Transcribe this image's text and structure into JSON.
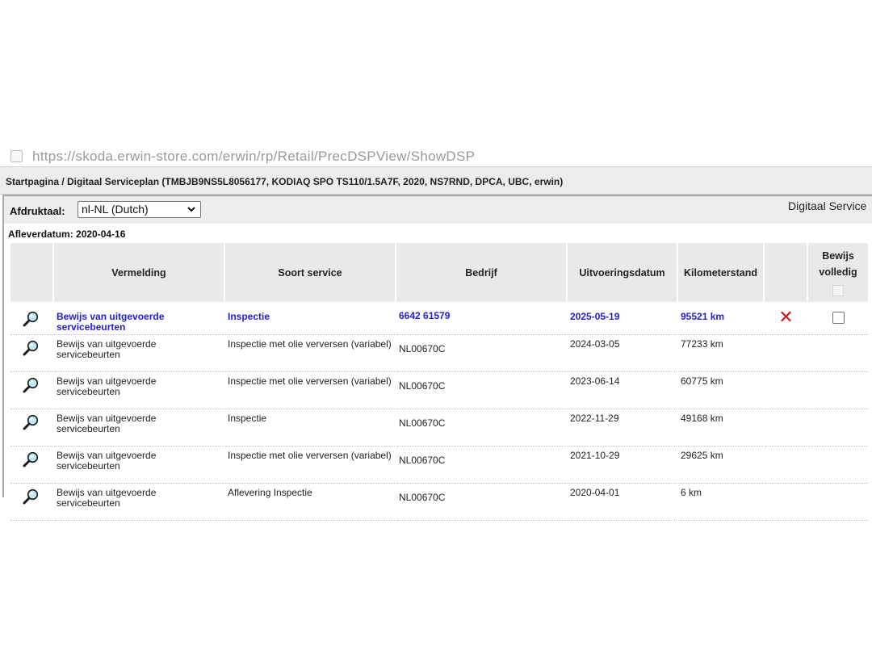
{
  "browser": {
    "url_fragment": "https://skoda.erwin-store.com/erwin/rp/Retail/PrecDSPView/ShowDSP"
  },
  "breadcrumb": "Startpagina / Digitaal Serviceplan (TMBJB9NS5L8056177, KODIAQ SPO TS110/1.5A7F, 2020, NS7RND, DPCA, UBC, erwin)",
  "toolbar": {
    "print_language_label": "Afdruktaal:",
    "print_language_value": "nl-NL (Dutch)",
    "title_partial": "Digitaal Service"
  },
  "delivery": "Afleverdatum: 2020-04-16",
  "table": {
    "headers": {
      "entry": "Vermelding",
      "service_type": "Soort service",
      "company": "Bedrijf",
      "date": "Uitvoeringsdatum",
      "mileage": "Kilometerstand",
      "proof_line1": "Bewijs",
      "proof_line2": "volledig"
    },
    "rows": [
      {
        "entry": "Bewijs van uitgevoerde servicebeurten",
        "service_type": "Inspectie",
        "company": "6642 61579",
        "date": "2025-05-19",
        "mileage": "95521 km",
        "highlight": true
      },
      {
        "entry": "Bewijs van uitgevoerde servicebeurten",
        "service_type": "Inspectie met olie verversen (variabel)",
        "company": "NL00670C",
        "date": "2024-03-05",
        "mileage": "77233 km"
      },
      {
        "entry": "Bewijs van uitgevoerde servicebeurten",
        "service_type": "Inspectie met olie verversen (variabel)",
        "company": "NL00670C",
        "date": "2023-06-14",
        "mileage": "60775 km"
      },
      {
        "entry": "Bewijs van uitgevoerde servicebeurten",
        "service_type": "Inspectie",
        "company": "NL00670C",
        "date": "2022-11-29",
        "mileage": "49168 km"
      },
      {
        "entry": "Bewijs van uitgevoerde servicebeurten",
        "service_type": "Inspectie met olie verversen (variabel)",
        "company": "NL00670C",
        "date": "2021-10-29",
        "mileage": "29625 km"
      },
      {
        "entry": "Bewijs van uitgevoerde servicebeurten",
        "service_type": "Aflevering Inspectie",
        "company": "NL00670C",
        "date": "2020-04-01",
        "mileage": "6 km"
      }
    ]
  },
  "colors": {
    "link_blue": "#1f1fd6",
    "delete_red": "#d31616"
  },
  "icons": {
    "view": "magnifier-icon",
    "delete": "delete-x-icon"
  }
}
